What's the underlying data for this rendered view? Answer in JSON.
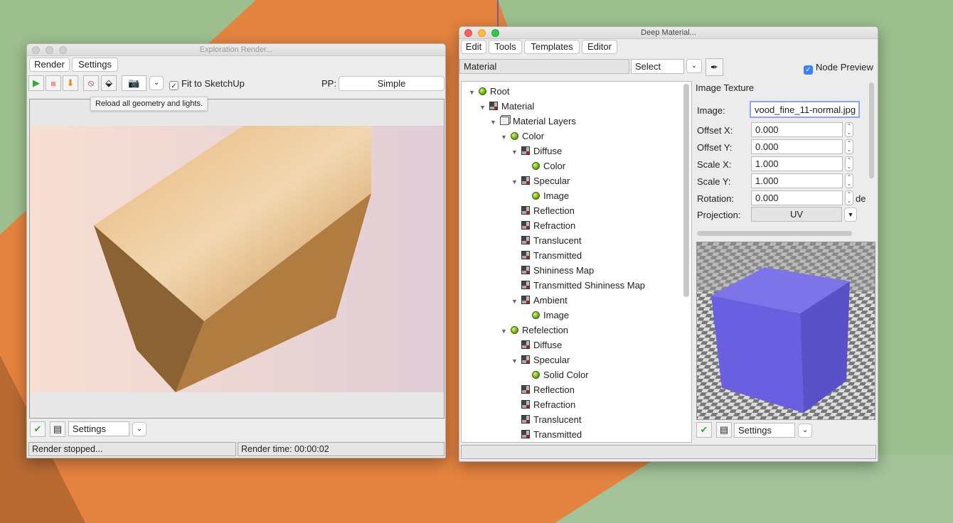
{
  "render_window": {
    "title": "Exploration Render...",
    "menu": [
      "Render",
      "Settings"
    ],
    "toolbar_icons": [
      "play-icon",
      "stop-icon",
      "save-icon",
      "reload-icon",
      "material-icon",
      "camera-icon"
    ],
    "fit_label": "Fit to SketchUp",
    "fit_checked": true,
    "pp_label": "PP:",
    "pp_value": "Simple",
    "tooltip": "Reload all geometry and lights.",
    "settings_value": "Settings",
    "status_left": "Render stopped...",
    "status_right": "Render time: 00:00:02"
  },
  "material_window": {
    "title": "Deep Material...",
    "menu": [
      "Edit",
      "Tools",
      "Templates",
      "Editor"
    ],
    "material_field": "Material",
    "select_value": "Select",
    "node_preview_label": "Node Preview",
    "node_preview_checked": true,
    "tree": [
      {
        "label": "Root",
        "level": 0,
        "icon": "ball",
        "expanded": true
      },
      {
        "label": "Material",
        "level": 1,
        "icon": "grid",
        "expanded": true
      },
      {
        "label": "Material Layers",
        "level": 2,
        "icon": "layers",
        "expanded": true
      },
      {
        "label": "Color",
        "level": 3,
        "icon": "ball",
        "expanded": true
      },
      {
        "label": "Diffuse",
        "level": 4,
        "icon": "grid",
        "expanded": true
      },
      {
        "label": "Color",
        "level": 5,
        "icon": "ball"
      },
      {
        "label": "Specular",
        "level": 4,
        "icon": "grid",
        "expanded": true
      },
      {
        "label": "Image",
        "level": 5,
        "icon": "ball"
      },
      {
        "label": "Reflection",
        "level": 4,
        "icon": "grid"
      },
      {
        "label": "Refraction",
        "level": 4,
        "icon": "grid"
      },
      {
        "label": "Translucent",
        "level": 4,
        "icon": "grid"
      },
      {
        "label": "Transmitted",
        "level": 4,
        "icon": "grid"
      },
      {
        "label": "Shininess Map",
        "level": 4,
        "icon": "grid"
      },
      {
        "label": "Transmitted Shininess Map",
        "level": 4,
        "icon": "grid"
      },
      {
        "label": "Ambient",
        "level": 4,
        "icon": "grid",
        "expanded": true
      },
      {
        "label": "Image",
        "level": 5,
        "icon": "ball"
      },
      {
        "label": "Refelection",
        "level": 3,
        "icon": "ball",
        "expanded": true
      },
      {
        "label": "Diffuse",
        "level": 4,
        "icon": "grid"
      },
      {
        "label": "Specular",
        "level": 4,
        "icon": "grid",
        "expanded": true
      },
      {
        "label": "Solid Color",
        "level": 5,
        "icon": "ball"
      },
      {
        "label": "Reflection",
        "level": 4,
        "icon": "grid"
      },
      {
        "label": "Refraction",
        "level": 4,
        "icon": "grid"
      },
      {
        "label": "Translucent",
        "level": 4,
        "icon": "grid"
      },
      {
        "label": "Transmitted",
        "level": 4,
        "icon": "grid"
      }
    ],
    "props": {
      "header": "Image Texture",
      "image_label": "Image:",
      "image_value": "vood_fine_11-normal.jpg",
      "fields": [
        {
          "label": "Offset X:",
          "value": "0.000"
        },
        {
          "label": "Offset Y:",
          "value": "0.000"
        },
        {
          "label": "Scale X:",
          "value": "1.000"
        },
        {
          "label": "Scale Y:",
          "value": "1.000"
        },
        {
          "label": "Rotation:",
          "value": "0.000",
          "unit": "de"
        }
      ],
      "projection_label": "Projection:",
      "projection_value": "UV"
    },
    "settings_value": "Settings",
    "preview_cube_color": "#6a5fe0"
  }
}
